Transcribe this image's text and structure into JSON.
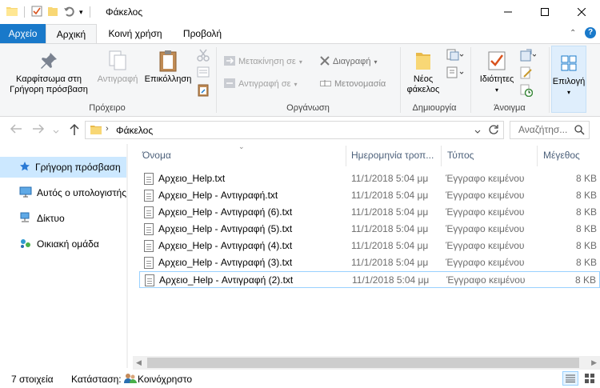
{
  "window": {
    "title": "Φάκελος"
  },
  "tabs": {
    "file": "Αρχείο",
    "home": "Αρχική",
    "share": "Κοινή χρήση",
    "view": "Προβολή"
  },
  "ribbon": {
    "clipboard": {
      "label": "Πρόχειρο",
      "pin_line1": "Καρφίτσωμα στη",
      "pin_line2": "Γρήγορη πρόσβαση",
      "copy": "Αντιγραφή",
      "paste": "Επικόλληση"
    },
    "organize": {
      "label": "Οργάνωση",
      "move_to": "Μετακίνηση σε",
      "copy_to": "Αντιγραφή σε",
      "delete": "Διαγραφή",
      "rename": "Μετονομασία"
    },
    "new": {
      "label": "Δημιουργία",
      "new_folder_line1": "Νέος",
      "new_folder_line2": "φάκελος"
    },
    "open": {
      "label": "Άνοιγμα",
      "properties": "Ιδιότητες"
    },
    "select": {
      "label": "Επιλογή"
    }
  },
  "address": {
    "path": "Φάκελος",
    "search_placeholder": "Αναζήτησ..."
  },
  "nav": {
    "items": [
      {
        "label": "Γρήγορη πρόσβαση",
        "icon": "star-icon"
      },
      {
        "label": "Αυτός ο υπολογιστής",
        "icon": "computer-icon"
      },
      {
        "label": "Δίκτυο",
        "icon": "network-icon"
      },
      {
        "label": "Οικιακή ομάδα",
        "icon": "homegroup-icon"
      }
    ]
  },
  "columns": {
    "name": "Όνομα",
    "date": "Ημερομηνία τροπ...",
    "type": "Τύπος",
    "size": "Μέγεθος"
  },
  "files": [
    {
      "name": "Αρχειο_Help.txt",
      "date": "11/1/2018 5:04 μμ",
      "type": "Έγγραφο κειμένου",
      "size": "8 KB"
    },
    {
      "name": "Αρχειο_Help - Αντιγραφή.txt",
      "date": "11/1/2018 5:04 μμ",
      "type": "Έγγραφο κειμένου",
      "size": "8 KB"
    },
    {
      "name": "Αρχειο_Help - Αντιγραφή (6).txt",
      "date": "11/1/2018 5:04 μμ",
      "type": "Έγγραφο κειμένου",
      "size": "8 KB"
    },
    {
      "name": "Αρχειο_Help - Αντιγραφή (5).txt",
      "date": "11/1/2018 5:04 μμ",
      "type": "Έγγραφο κειμένου",
      "size": "8 KB"
    },
    {
      "name": "Αρχειο_Help - Αντιγραφή (4).txt",
      "date": "11/1/2018 5:04 μμ",
      "type": "Έγγραφο κειμένου",
      "size": "8 KB"
    },
    {
      "name": "Αρχειο_Help - Αντιγραφή (3).txt",
      "date": "11/1/2018 5:04 μμ",
      "type": "Έγγραφο κειμένου",
      "size": "8 KB"
    },
    {
      "name": "Αρχειο_Help - Αντιγραφή (2).txt",
      "date": "11/1/2018 5:04 μμ",
      "type": "Έγγραφο κειμένου",
      "size": "8 KB"
    }
  ],
  "status": {
    "count": "7 στοιχεία",
    "state_label": "Κατάσταση:",
    "state_value": "Κοινόχρηστο"
  },
  "colors": {
    "accent": "#1979ca",
    "selection": "#cce8ff",
    "focus_border": "#99d1ff"
  }
}
